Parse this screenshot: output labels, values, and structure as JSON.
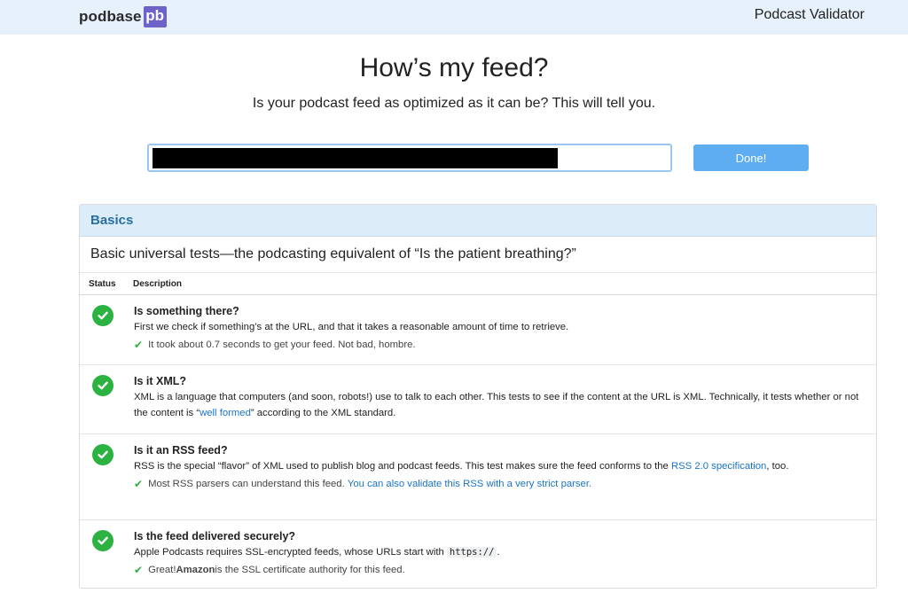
{
  "header": {
    "logo_text": "podbase",
    "logo_mark": "pb",
    "app_name": "Podcast Validator"
  },
  "hero": {
    "title": "How’s my feed?",
    "subtitle": "Is your podcast feed as optimized as it can be? This will tell you."
  },
  "form": {
    "url_value": "",
    "submit_label": "Done!"
  },
  "colors": {
    "topbar": "#e6f1fb",
    "brand_mark": "#6e63c8",
    "button": "#5dadf0",
    "panel_header": "#dcecf8",
    "panel_title": "#2a6fa1",
    "success": "#2bb241",
    "link": "#1a73c8"
  },
  "basics": {
    "title": "Basics",
    "description": "Basic universal tests—the podcasting equivalent of “Is the patient breathing?”",
    "columns": {
      "status": "Status",
      "description": "Description"
    },
    "rows": [
      {
        "status_icon": "check-circle-icon",
        "title": "Is something there?",
        "text": "First we check if something’s at the URL, and that it takes a reasonable amount of time to retrieve.",
        "result": "It took about 0.7 seconds to get your feed. Not bad, hombre."
      },
      {
        "status_icon": "check-circle-icon",
        "title": "Is it XML?",
        "text_before": "XML is a language that computers (and soon, robots!) use to talk to each other. This tests to see if the content at the URL is XML. Technically, it tests whether or not the content is “",
        "text_link": "well formed",
        "text_after": "” according to the XML standard."
      },
      {
        "status_icon": "check-circle-icon",
        "title": "Is it an RSS feed?",
        "text_before": "RSS is the special “flavor” of XML used to publish blog and podcast feeds. This test makes sure the feed conforms to the ",
        "text_link": "RSS 2.0 specification",
        "text_after": ", too.",
        "result": "Most RSS parsers can understand this feed.",
        "result_link": "You can also validate this RSS with a very strict parser."
      },
      {
        "status_icon": "check-circle-icon",
        "title": "Is the feed delivered securely?",
        "text_before": "Apple Podcasts requires SSL-encrypted feeds, whose URLs start with ",
        "text_code": "https://",
        "text_after": ".",
        "result_before": "Great! ",
        "result_bold": "Amazon",
        "result_after": " is the SSL certificate authority for this feed."
      }
    ]
  }
}
